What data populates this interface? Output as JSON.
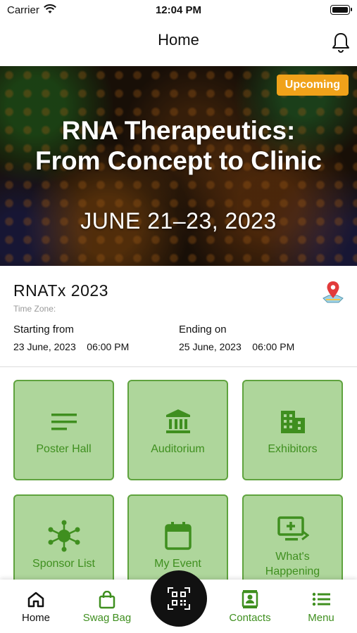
{
  "status_bar": {
    "carrier": "Carrier",
    "time": "12:04 PM"
  },
  "nav": {
    "title": "Home",
    "bell_icon": "bell-icon"
  },
  "banner": {
    "badge": "Upcoming",
    "title_line1": "RNA Therapeutics:",
    "title_line2": "From Concept to Clinic",
    "dates": "JUNE 21–23, 2023"
  },
  "event": {
    "name": "RNATx 2023",
    "timezone_label": "Time Zone:",
    "start_label": "Starting from",
    "start_value": "23 June, 2023    06:00 PM",
    "end_label": "Ending on",
    "end_value": "25 June, 2023    06:00 PM"
  },
  "tiles": [
    {
      "label": "Poster Hall",
      "icon": "lines-icon"
    },
    {
      "label": "Auditorium",
      "icon": "building-columns-icon"
    },
    {
      "label": "Exhibitors",
      "icon": "office-building-icon"
    },
    {
      "label": "Sponsor List",
      "icon": "hub-icon"
    },
    {
      "label": "My Event",
      "icon": "calendar-icon"
    },
    {
      "label_line1": "What's",
      "label_line2": "Happening",
      "icon": "monitor-plus-icon"
    }
  ],
  "tab_bar": {
    "home": "Home",
    "swag_bag": "Swag Bag",
    "contacts": "Contacts",
    "menu": "Menu"
  },
  "colors": {
    "accent_green": "#3f8f1f",
    "tile_bg": "#aed69b",
    "tile_border": "#5fa33e",
    "badge_orange": "#f0a21a"
  }
}
